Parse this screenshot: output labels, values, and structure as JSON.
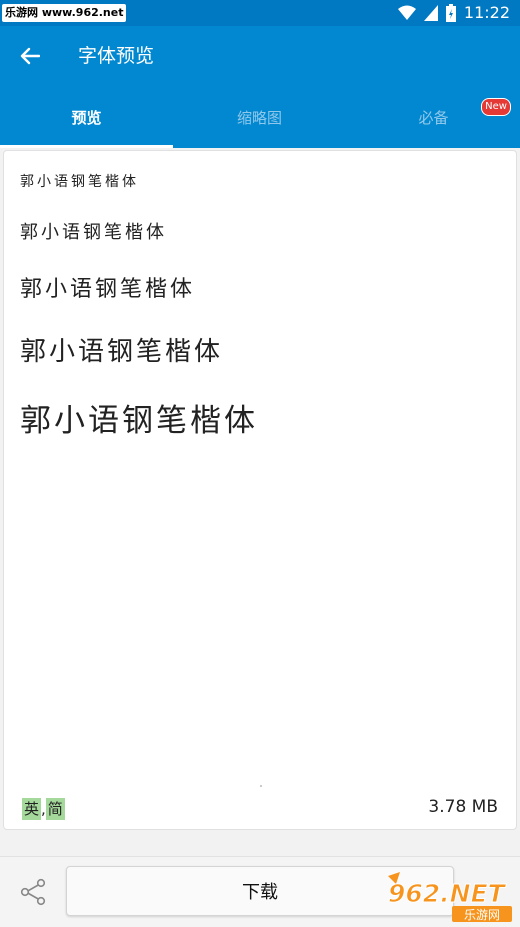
{
  "status_bar": {
    "watermark": "乐游网 www.962.net",
    "time": "11:22"
  },
  "app_bar": {
    "title": "字体预览",
    "back_icon": "arrow-left-icon"
  },
  "tabs": [
    {
      "label": "预览",
      "active": true
    },
    {
      "label": "缩略图",
      "active": false
    },
    {
      "label": "必备",
      "active": false,
      "badge": "New"
    }
  ],
  "preview": {
    "samples": [
      "郭小语钢笔楷体",
      "郭小语钢笔楷体",
      "郭小语钢笔楷体",
      "郭小语钢笔楷体",
      "郭小语钢笔楷体"
    ],
    "lang_tags": [
      "英",
      "简"
    ],
    "lang_separator": ",",
    "file_size": "3.78 MB"
  },
  "bottom_bar": {
    "share_icon": "share-icon",
    "download_label": "下载"
  },
  "corner_logo": {
    "text": "962.NET",
    "subtext": "乐游网"
  },
  "colors": {
    "status_bar": "#0079c2",
    "app_bar": "#0288d1",
    "badge": "#e53935",
    "lang_tag": "#a5d89b"
  }
}
